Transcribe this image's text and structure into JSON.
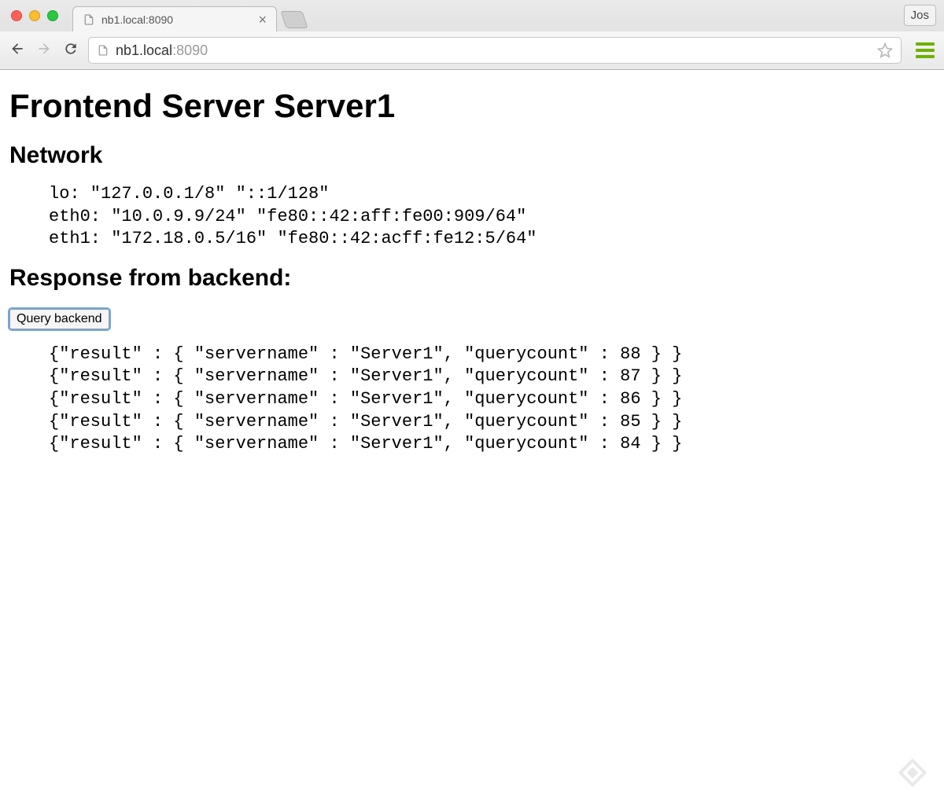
{
  "browser": {
    "profile": "Jos",
    "tab_title": "nb1.local:8090",
    "url_host": "nb1.local",
    "url_port": ":8090"
  },
  "page": {
    "h1": "Frontend Server Server1",
    "h2_network": "Network",
    "h2_response": "Response from backend:",
    "query_button": "Query backend",
    "network": [
      "lo: \"127.0.0.1/8\" \"::1/128\"",
      "eth0: \"10.0.9.9/24\" \"fe80::42:aff:fe00:909/64\"",
      "eth1: \"172.18.0.5/16\" \"fe80::42:acff:fe12:5/64\""
    ],
    "responses": [
      "{\"result\" : { \"servername\" : \"Server1\", \"querycount\" : 88 } }",
      "{\"result\" : { \"servername\" : \"Server1\", \"querycount\" : 87 } }",
      "{\"result\" : { \"servername\" : \"Server1\", \"querycount\" : 86 } }",
      "{\"result\" : { \"servername\" : \"Server1\", \"querycount\" : 85 } }",
      "{\"result\" : { \"servername\" : \"Server1\", \"querycount\" : 84 } }"
    ]
  }
}
